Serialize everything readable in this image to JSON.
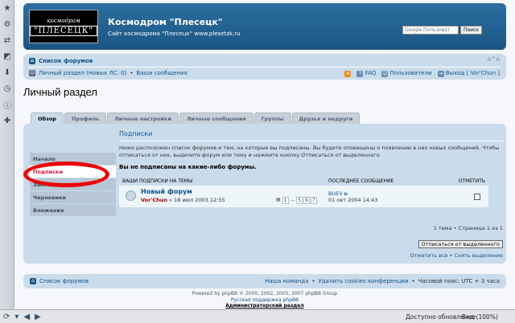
{
  "site": {
    "title": "Космодром \"Плесецк\"",
    "description": "Сайт космодрома \"Плесецк\" www.plesetzk.ru",
    "logo_top": "космодром",
    "logo_bottom": "\"ПЛЕСЕЦК\""
  },
  "search": {
    "placeholder": "Google Пользоват",
    "button": "Поиск"
  },
  "navbar": {
    "forum_list": "Список форумов",
    "personal": "Личный раздел (Новых ЛС: 0)",
    "messages": "Ваши сообщения",
    "faq": "FAQ",
    "users": "Пользователи",
    "logout": "Выход [ Vor'Chun ]"
  },
  "page_title": "Личный раздел",
  "tabs": [
    "Обзор",
    "Профиль",
    "Личные настройки",
    "Личные сообщения",
    "Группы",
    "Друзья и недруги"
  ],
  "menu": [
    "Начало",
    "Подписки",
    "Закладки",
    "Черновики",
    "Вложения"
  ],
  "content": {
    "heading": "Подписки",
    "intro": "Ниже расположен список форумов и тем, на которые вы подписаны. Вы будете оповещены о появлении в них новых сообщений. Чтобы отписаться от них, выделите форум или тему и нажмите кнопку",
    "intro_italic": "Отписаться от выделенного",
    "warning": "Вы не подписаны на какие-либо форумы."
  },
  "table": {
    "headers": {
      "topic": "ВАШИ ПОДПИСКИ НА ТЕМЫ",
      "last": "ПОСЛЕДНЕЕ СООБЩЕНИЕ",
      "mark": "ОТМЕТИТЬ"
    },
    "row": {
      "title": "Новый форум",
      "author": "Vor'Chun",
      "date": "» 18 июл 2003 12:55",
      "pages": [
        "1",
        "...",
        "5",
        "6",
        "7"
      ],
      "last_author": "BUEV",
      "last_date": "01 окт 2004 14:43"
    }
  },
  "pagination": "1 тема • Страница 1 из 1",
  "unsubscribe_button": "Отписаться от выделенного",
  "mark_all": "Отметить все",
  "unmark": "Снять выделение",
  "footer": {
    "forum_list": "Список форумов",
    "team": "Наша команда",
    "delete_cookies": "Удалить cookies конференции",
    "timezone": "Часовой пояс: UTC + 3 часа",
    "powered": "Powered by phpBB © 2000, 2002, 2005, 2007 phpBB Group",
    "support": "Русская поддержка phpBB",
    "admin": "Администраторский раздел"
  },
  "status": {
    "done": "Доступно обновление",
    "zoom": "Вид (100%)"
  },
  "colors": {
    "header": "#1b5685",
    "accent": "#cadceb",
    "oval": "#ee0000"
  }
}
